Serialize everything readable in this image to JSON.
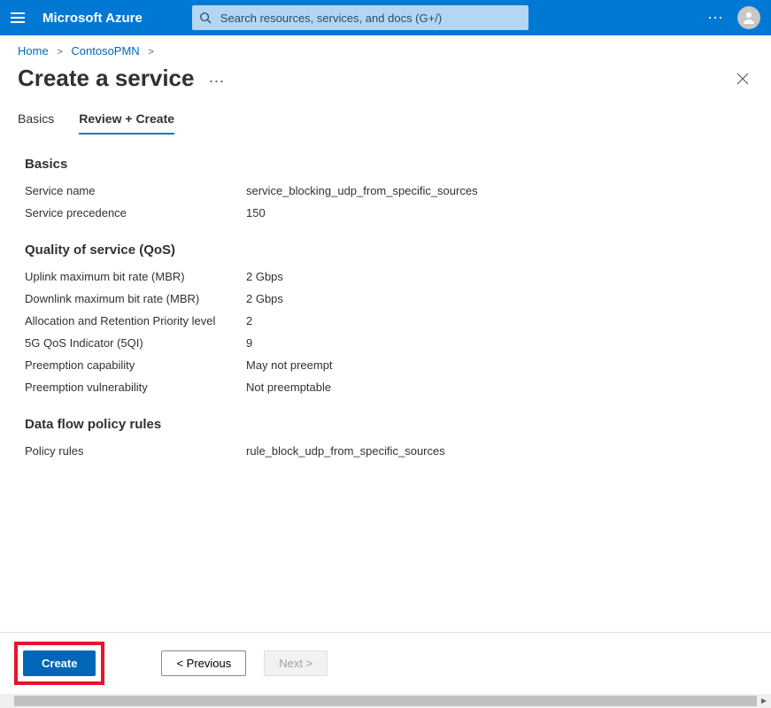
{
  "header": {
    "brand": "Microsoft Azure",
    "search_placeholder": "Search resources, services, and docs (G+/)"
  },
  "breadcrumb": {
    "home": "Home",
    "resource": "ContosoPMN"
  },
  "title": "Create a service",
  "tabs": {
    "basics": "Basics",
    "review": "Review + Create"
  },
  "sections": {
    "basics": {
      "heading": "Basics",
      "service_name": {
        "label": "Service name",
        "value": "service_blocking_udp_from_specific_sources"
      },
      "service_precedence": {
        "label": "Service precedence",
        "value": "150"
      }
    },
    "qos": {
      "heading": "Quality of service (QoS)",
      "uplink_mbr": {
        "label": "Uplink maximum bit rate (MBR)",
        "value": "2 Gbps"
      },
      "downlink_mbr": {
        "label": "Downlink maximum bit rate (MBR)",
        "value": "2 Gbps"
      },
      "arp_level": {
        "label": "Allocation and Retention Priority level",
        "value": "2"
      },
      "fiveqi": {
        "label": "5G QoS Indicator (5QI)",
        "value": "9"
      },
      "preempt_cap": {
        "label": "Preemption capability",
        "value": "May not preempt"
      },
      "preempt_vuln": {
        "label": "Preemption vulnerability",
        "value": "Not preemptable"
      }
    },
    "rules": {
      "heading": "Data flow policy rules",
      "policy_rules": {
        "label": "Policy rules",
        "value": "rule_block_udp_from_specific_sources"
      }
    }
  },
  "footer": {
    "create": "Create",
    "previous": "< Previous",
    "next": "Next >"
  }
}
